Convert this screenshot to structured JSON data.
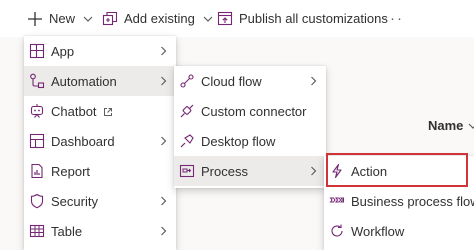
{
  "toolbar": {
    "new_label": "New",
    "add_existing_label": "Add existing",
    "publish_label": "Publish all customizations",
    "more_label": "···"
  },
  "table": {
    "name_header": "Name"
  },
  "menu_level1": {
    "items": [
      {
        "label": "App",
        "icon": "app-grid-icon",
        "has_submenu": true
      },
      {
        "label": "Automation",
        "icon": "automation-flow-icon",
        "has_submenu": true,
        "active": true
      },
      {
        "label": "Chatbot",
        "icon": "chatbot-icon",
        "external": true
      },
      {
        "label": "Dashboard",
        "icon": "dashboard-icon",
        "has_submenu": true
      },
      {
        "label": "Report",
        "icon": "report-icon"
      },
      {
        "label": "Security",
        "icon": "shield-icon",
        "has_submenu": true
      },
      {
        "label": "Table",
        "icon": "table-icon",
        "has_submenu": true
      }
    ]
  },
  "menu_automation": {
    "items": [
      {
        "label": "Cloud flow",
        "icon": "cloud-flow-icon",
        "has_submenu": true
      },
      {
        "label": "Custom connector",
        "icon": "connector-icon"
      },
      {
        "label": "Desktop flow",
        "icon": "desktop-flow-icon"
      },
      {
        "label": "Process",
        "icon": "process-icon",
        "has_submenu": true,
        "active": true
      }
    ]
  },
  "menu_process": {
    "items": [
      {
        "label": "Action",
        "icon": "lightning-icon",
        "highlighted": true
      },
      {
        "label": "Business process flow",
        "icon": "business-process-flow-icon"
      },
      {
        "label": "Workflow",
        "icon": "workflow-icon"
      }
    ]
  },
  "colors": {
    "accent": "#742774",
    "highlight_border": "#d13438",
    "active_bg": "#edebe9"
  }
}
